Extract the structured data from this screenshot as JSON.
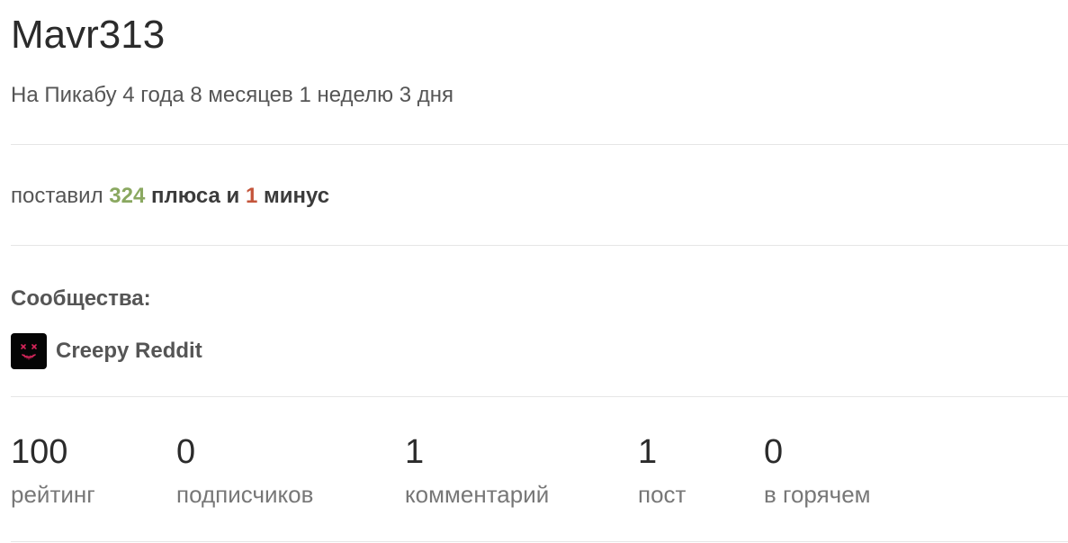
{
  "profile": {
    "username": "Mavr313",
    "tenure": "На Пикабу 4 года 8 месяцев 1 неделю 3 дня"
  },
  "votes": {
    "prefix": "поставил",
    "plus_count": "324",
    "plus_label": "плюса и",
    "minus_count": "1",
    "minus_label": "минус",
    "colors": {
      "plus": "#8aa860",
      "minus": "#c4553b"
    }
  },
  "communities": {
    "title": "Сообщества:",
    "items": [
      {
        "name": "Creepy Reddit",
        "icon": "masked-face-avatar"
      }
    ]
  },
  "stats": [
    {
      "value": "100",
      "label": "рейтинг"
    },
    {
      "value": "0",
      "label": "подписчиков"
    },
    {
      "value": "1",
      "label": "комментарий"
    },
    {
      "value": "1",
      "label": "пост"
    },
    {
      "value": "0",
      "label": "в горячем"
    }
  ]
}
